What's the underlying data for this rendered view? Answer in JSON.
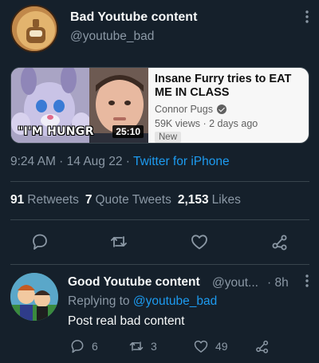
{
  "tweet": {
    "display_name": "Bad Youtube content",
    "handle": "@youtube_bad",
    "more_icon": "more-dots-icon"
  },
  "video_card": {
    "thumbnail_caption": "\"I'M HUNGR",
    "duration": "25:10",
    "title": "Insane Furry tries to EAT ME IN CLASS",
    "channel": "Connor Pugs",
    "views_age": "59K views · 2 days ago",
    "badge": "New"
  },
  "meta": {
    "time": "9:24 AM",
    "sep1": " · ",
    "date": "14 Aug 22",
    "sep2": " · ",
    "source": "Twitter for iPhone"
  },
  "stats": {
    "retweets_count": "91",
    "retweets_label": "Retweets",
    "quotes_count": "7",
    "quotes_label": "Quote Tweets",
    "likes_count": "2,153",
    "likes_label": "Likes"
  },
  "actions": [
    "reply-icon",
    "retweet-icon",
    "like-icon",
    "share-icon"
  ],
  "reply": {
    "display_name": "Good Youtube content",
    "handle": "@yout...",
    "time": "· 8h",
    "replying_prefix": "Replying to",
    "replying_mention": "@youtube_bad",
    "text": "Post real bad content",
    "reply_count": "6",
    "retweet_count": "3",
    "like_count": "49"
  },
  "colors": {
    "background": "#15202b",
    "primary_text": "#f7f9f9",
    "secondary_text": "#8b98a5",
    "accent": "#1d9bf0",
    "divider": "#38444d"
  }
}
